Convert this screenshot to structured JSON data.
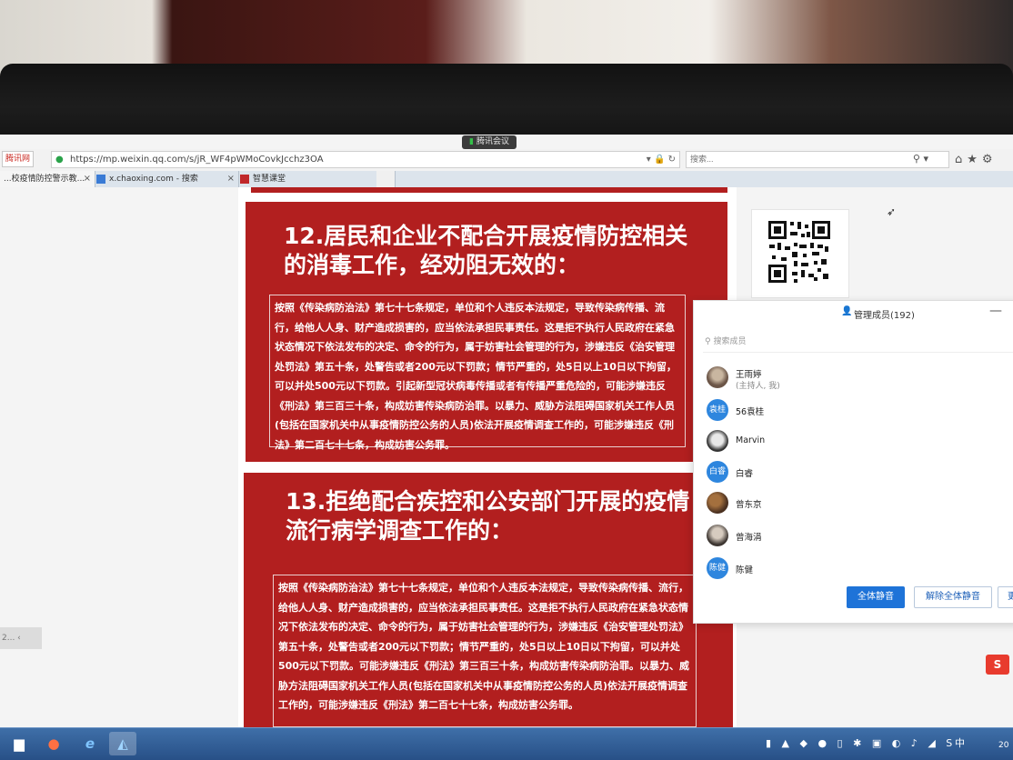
{
  "meeting": {
    "label": "腾讯会议"
  },
  "browser": {
    "left_tag": "腾讯网",
    "url": "https://mp.weixin.qq.com/s/jR_WF4pWMoCovkJcchz3OA",
    "search_placeholder": "搜索...",
    "tabs": [
      {
        "label": "...校疫情防控警示教...",
        "close": "×"
      },
      {
        "label": "x.chaoxing.com - 搜索",
        "close": "×"
      },
      {
        "label": "智慧课堂",
        "close": ""
      }
    ]
  },
  "article": {
    "sections": [
      {
        "title": "12.居民和企业不配合开展疫情防控相关的消毒工作，经劝阻无效的：",
        "body": "按照《传染病防治法》第七十七条规定，单位和个人违反本法规定，导致传染病传播、流行，给他人人身、财产造成损害的，应当依法承担民事责任。这是拒不执行人民政府在紧急状态情况下依法发布的决定、命令的行为，属于妨害社会管理的行为，涉嫌违反《治安管理处罚法》第五十条，处警告或者200元以下罚款；情节严重的，处5日以上10日以下拘留，可以并处500元以下罚款。引起新型冠状病毒传播或者有传播严重危险的，可能涉嫌违反《刑法》第三百三十条，构成妨害传染病防治罪。以暴力、威胁方法阻碍国家机关工作人员(包括在国家机关中从事疫情防控公务的人员)依法开展疫情调查工作的，可能涉嫌违反《刑法》第二百七十七条，构成妨害公务罪。"
      },
      {
        "title": "13.拒绝配合疾控和公安部门开展的疫情流行病学调查工作的：",
        "body": "按照《传染病防治法》第七十七条规定，单位和个人违反本法规定，导致传染病传播、流行，给他人人身、财产造成损害的，应当依法承担民事责任。这是拒不执行人民政府在紧急状态情况下依法发布的决定、命令的行为，属于妨害社会管理的行为，涉嫌违反《治安管理处罚法》第五十条，处警告或者200元以下罚款；情节严重的，处5日以上10日以下拘留，可以并处500元以下罚款。可能涉嫌违反《刑法》第三百三十条，构成妨害传染病防治罪。以暴力、威胁方法阻碍国家机关工作人员(包括在国家机关中从事疫情防控公务的人员)依法开展疫情调查工作的，可能涉嫌违反《刑法》第二百七十七条，构成妨害公务罪。"
      }
    ]
  },
  "member_panel": {
    "title": "管理成员(192)",
    "search_placeholder": "搜索成员",
    "members": [
      {
        "name": "王雨婷",
        "sub": "(主持人, 我)",
        "avatar_text": "",
        "avatar_style": "photo1"
      },
      {
        "name": "56袁桂",
        "sub": "",
        "avatar_text": "袁桂",
        "avatar_style": "blue"
      },
      {
        "name": "Marvin",
        "sub": "",
        "avatar_text": "",
        "avatar_style": "photo2"
      },
      {
        "name": "白睿",
        "sub": "",
        "avatar_text": "白睿",
        "avatar_style": "blue"
      },
      {
        "name": "曾东京",
        "sub": "",
        "avatar_text": "",
        "avatar_style": "photo3"
      },
      {
        "name": "曾海涓",
        "sub": "",
        "avatar_text": "",
        "avatar_style": "photo4"
      },
      {
        "name": "陈健",
        "sub": "",
        "avatar_text": "陈健",
        "avatar_style": "blue"
      }
    ],
    "buttons": {
      "mute_all": "全体静音",
      "unmute_all": "解除全体静音",
      "more": "更多"
    }
  },
  "side_control": {
    "label": "2..."
  },
  "taskbar": {
    "ime": "中",
    "clock": "20"
  },
  "colors": {
    "article_red": "#b21f1f",
    "accent_blue": "#1e73d8"
  }
}
